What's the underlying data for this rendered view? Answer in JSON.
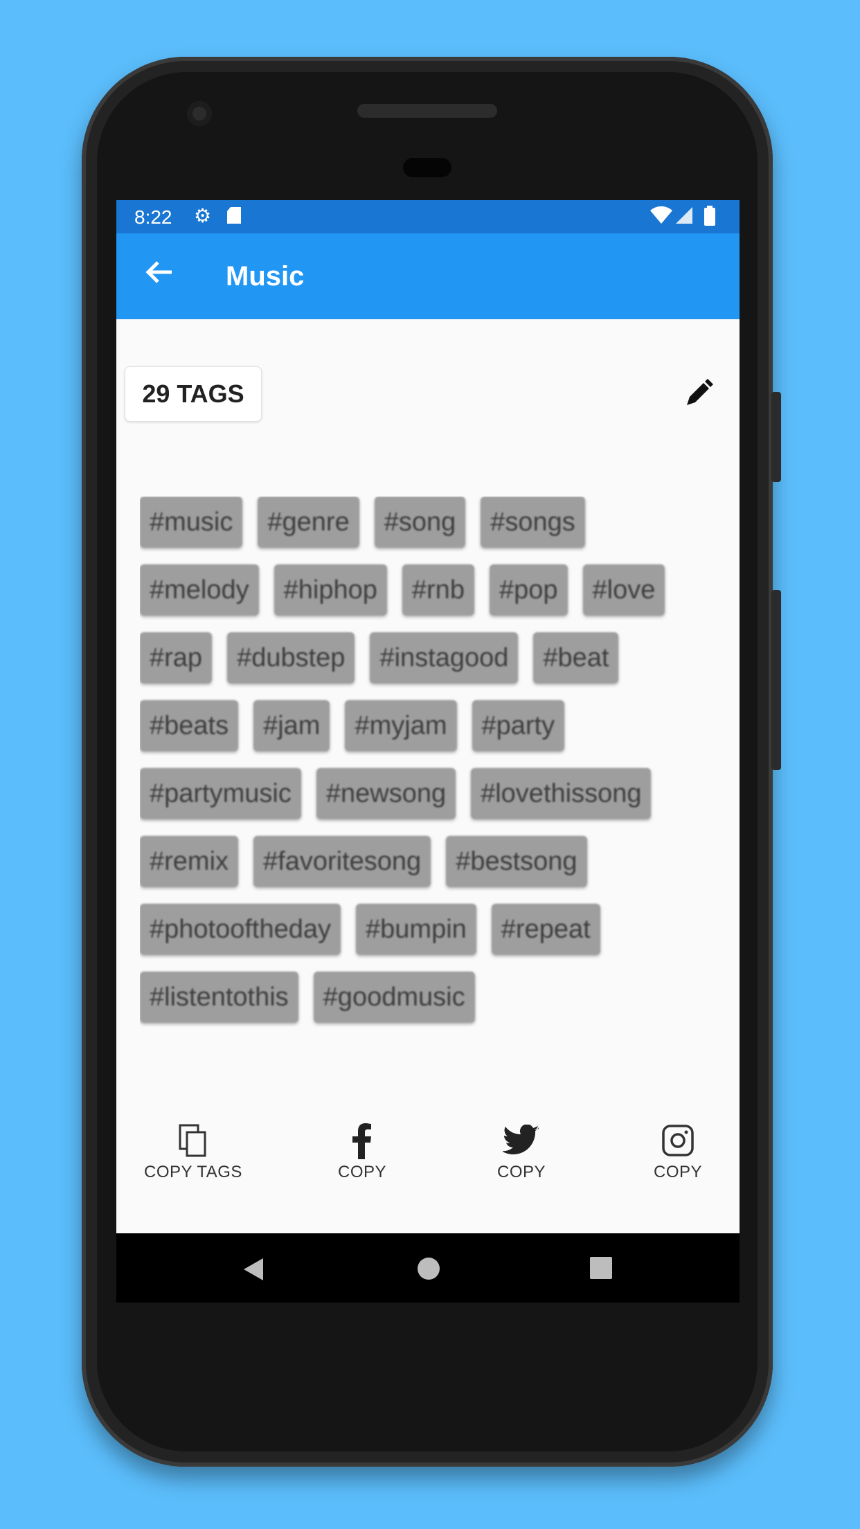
{
  "status_bar": {
    "time": "8:22",
    "left_icons": [
      "settings-icon",
      "sd-card-icon"
    ],
    "right_icons": [
      "wifi-icon",
      "signal-icon",
      "battery-icon"
    ]
  },
  "app_bar": {
    "back_icon": "arrow-back-icon",
    "title": "Music"
  },
  "tag_count_label": "29 TAGS",
  "edit_icon": "pencil-icon",
  "tags": [
    "#music",
    "#genre",
    "#song",
    "#songs",
    "#melody",
    "#hiphop",
    "#rnb",
    "#pop",
    "#love",
    "#rap",
    "#dubstep",
    "#instagood",
    "#beat",
    "#beats",
    "#jam",
    "#myjam",
    "#party",
    "#partymusic",
    "#newsong",
    "#lovethissong",
    "#remix",
    "#favoritesong",
    "#bestsong",
    "#photooftheday",
    "#bumpin",
    "#repeat",
    "#listentothis",
    "#goodmusic"
  ],
  "actions": [
    {
      "icon": "copy-icon",
      "label": "COPY TAGS"
    },
    {
      "icon": "facebook-icon",
      "label": "COPY"
    },
    {
      "icon": "twitter-icon",
      "label": "COPY"
    },
    {
      "icon": "instagram-icon",
      "label": "COPY"
    }
  ],
  "nav_bar": [
    "back-nav-icon",
    "home-nav-icon",
    "recents-nav-icon"
  ],
  "colors": {
    "background": "#5bbdfb",
    "status_bar": "#1976d2",
    "app_bar": "#2196f3",
    "chip": "#9e9e9e"
  }
}
